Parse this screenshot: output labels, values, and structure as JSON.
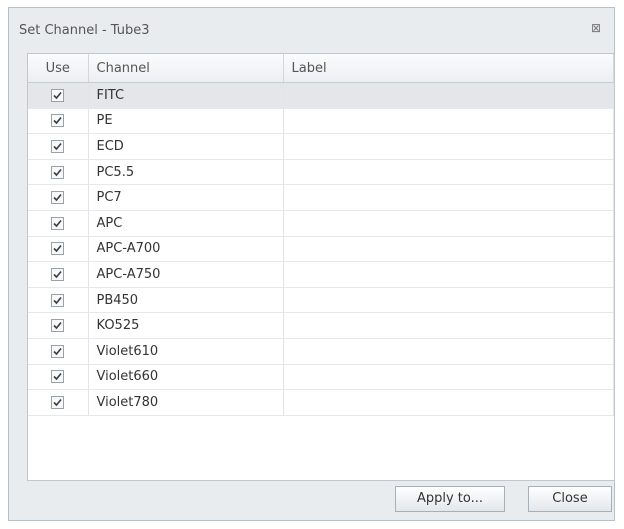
{
  "window": {
    "title": "Set Channel - Tube3",
    "close_glyph": "⊠"
  },
  "table": {
    "headers": {
      "use": "Use",
      "channel": "Channel",
      "label": "Label"
    },
    "rows": [
      {
        "checked": true,
        "channel": "FITC",
        "label": ""
      },
      {
        "checked": true,
        "channel": "PE",
        "label": ""
      },
      {
        "checked": true,
        "channel": "ECD",
        "label": ""
      },
      {
        "checked": true,
        "channel": "PC5.5",
        "label": ""
      },
      {
        "checked": true,
        "channel": "PC7",
        "label": ""
      },
      {
        "checked": true,
        "channel": "APC",
        "label": ""
      },
      {
        "checked": true,
        "channel": "APC-A700",
        "label": ""
      },
      {
        "checked": true,
        "channel": "APC-A750",
        "label": ""
      },
      {
        "checked": true,
        "channel": "PB450",
        "label": ""
      },
      {
        "checked": true,
        "channel": "KO525",
        "label": ""
      },
      {
        "checked": true,
        "channel": "Violet610",
        "label": ""
      },
      {
        "checked": true,
        "channel": "Violet660",
        "label": ""
      },
      {
        "checked": true,
        "channel": "Violet780",
        "label": ""
      }
    ],
    "selected_row": 0
  },
  "buttons": {
    "apply": "Apply to...",
    "close": "Close"
  }
}
